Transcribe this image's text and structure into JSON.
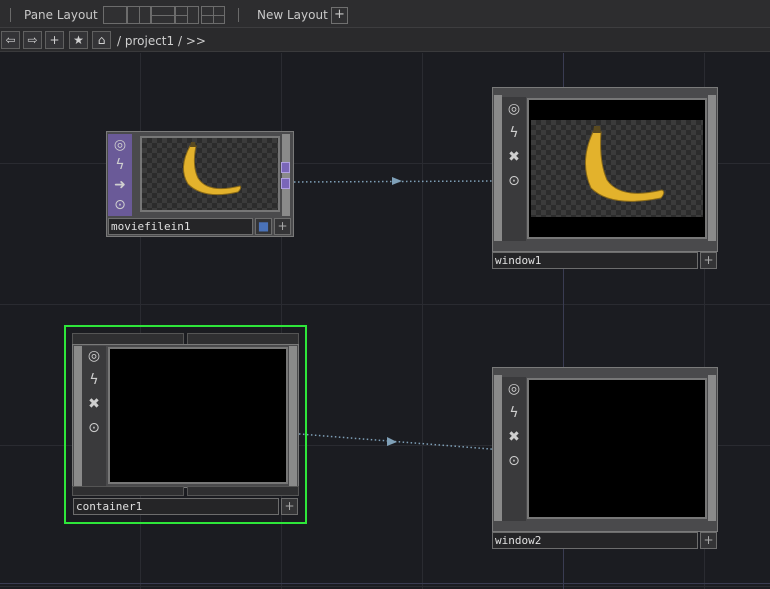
{
  "toolbar": {
    "pane_layout_label": "Pane Layout",
    "new_layout_label": "New Layout",
    "plus_symbol": "+"
  },
  "nav": {
    "back_icon": "⇦",
    "forward_icon": "⇨",
    "add_icon": "+",
    "star_icon": "★",
    "home_icon": "⌂",
    "path": "/ project1 / >>"
  },
  "nodes": {
    "moviefilein1": {
      "name": "moviefilein1"
    },
    "window1": {
      "name": "window1"
    },
    "container1": {
      "name": "container1"
    },
    "window2": {
      "name": "window2"
    }
  },
  "icons": {
    "viewer": "◎",
    "bypass": "ϟ",
    "cook": "➜",
    "close": "✖",
    "lock": "⊙",
    "plus": "+"
  },
  "colors": {
    "selection": "#2ee63a",
    "movie_node": "#6a5a98",
    "banana": "#e3b22c",
    "connector": "#7fa0b8"
  }
}
